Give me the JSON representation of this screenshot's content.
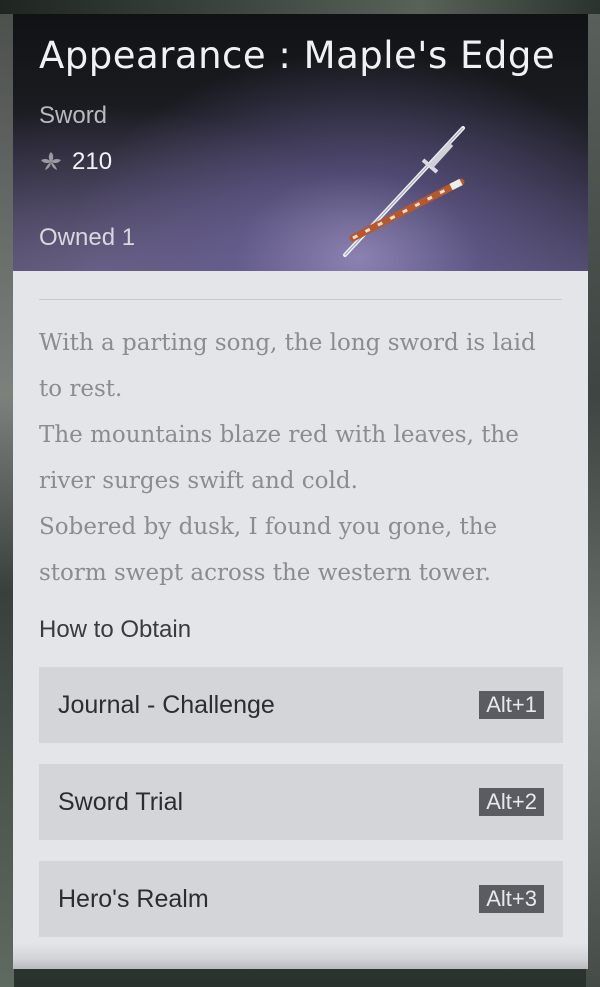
{
  "item": {
    "title": "Appearance : Maple's Edge",
    "type": "Sword",
    "price": "210",
    "currency_icon": "leaf-currency-icon",
    "owned": "Owned 1"
  },
  "description": [
    "With a parting song, the long sword is laid to rest.",
    "The mountains blaze red with leaves, the river surges swift and cold.",
    "Sobered by dusk, I found you gone, the storm swept across the western tower."
  ],
  "obtain": {
    "heading": "How to Obtain",
    "items": [
      {
        "label": "Journal - Challenge",
        "hotkey": "Alt+1"
      },
      {
        "label": "Sword Trial",
        "hotkey": "Alt+2"
      },
      {
        "label": "Hero's Realm",
        "hotkey": "Alt+3"
      }
    ]
  },
  "colors": {
    "panel": "#e4e5e8",
    "option_bg": "#d4d5d9",
    "hotkey_bg": "#5a5c62"
  }
}
